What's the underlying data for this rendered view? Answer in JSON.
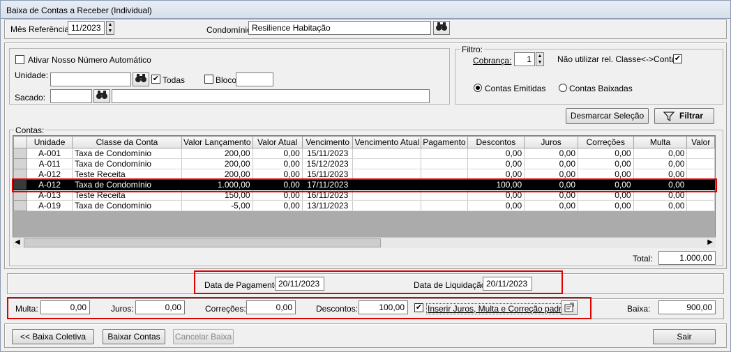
{
  "window": {
    "title": "Baixa de Contas a Receber (Individual)"
  },
  "header": {
    "mes_label": "Mês Referência:",
    "mes_value": "11/2023",
    "condominio_label": "Condomínio:",
    "condominio_value": "Resilience Habitação"
  },
  "options": {
    "ativar_label": "Ativar Nosso Número Automático",
    "unidade_label": "Unidade:",
    "unidade_value": "",
    "todas_label": "Todas",
    "bloco_label": "Bloco",
    "bloco_value": "",
    "sacado_label": "Sacado:",
    "sacado_code": "",
    "sacado_name": ""
  },
  "filter": {
    "legend": "Filtro:",
    "cobranca_label": "Cobrança:",
    "cobranca_value": "1",
    "nao_utilizar_label": "Não utilizar rel. Classe<->Conta",
    "contas_emitidas_label": "Contas Emitidas",
    "contas_baixadas_label": "Contas Baixadas",
    "desmarcar_label": "Desmarcar Seleção",
    "filtrar_label": "Filtrar"
  },
  "contas": {
    "legend": "Contas:",
    "columns": [
      "",
      "Unidade",
      "Classe da Conta",
      "Valor Lançamento",
      "Valor Atual",
      "Vencimento",
      "Vencimento Atual",
      "Pagamento",
      "Descontos",
      "Juros",
      "Correções",
      "Multa",
      "Valor"
    ],
    "rows": [
      [
        "A-001",
        "Taxa de Condomínio",
        "200,00",
        "0,00",
        "15/11/2023",
        "",
        "",
        "0,00",
        "0,00",
        "0,00",
        "0,00"
      ],
      [
        "A-011",
        "Taxa de Condomínio",
        "200,00",
        "0,00",
        "15/12/2023",
        "",
        "",
        "0,00",
        "0,00",
        "0,00",
        "0,00"
      ],
      [
        "A-012",
        "Teste Receita",
        "200,00",
        "0,00",
        "15/11/2023",
        "",
        "",
        "0,00",
        "0,00",
        "0,00",
        "0,00"
      ],
      [
        "A-012",
        "Taxa de Condomínio",
        "1.000,00",
        "0,00",
        "17/11/2023",
        "",
        "",
        "100,00",
        "0,00",
        "0,00",
        "0,00"
      ],
      [
        "A-013",
        "Teste Receita",
        "150,00",
        "0,00",
        "16/11/2023",
        "",
        "",
        "0,00",
        "0,00",
        "0,00",
        "0,00"
      ],
      [
        "A-019",
        "Taxa de Condomínio",
        "-5,00",
        "0,00",
        "13/11/2023",
        "",
        "",
        "0,00",
        "0,00",
        "0,00",
        "0,00"
      ]
    ],
    "selected_row": 3,
    "total_label": "Total:",
    "total_value": "1.000,00"
  },
  "datas": {
    "pagamento_label": "Data de Pagamento:",
    "pagamento_value": "20/11/2023",
    "liquidacao_label": "Data de Liquidação:",
    "liquidacao_value": "20/11/2023"
  },
  "valores": {
    "multa_label": "Multa:",
    "multa_value": "0,00",
    "juros_label": "Juros:",
    "juros_value": "0,00",
    "correcoes_label": "Correções:",
    "correcoes_value": "0,00",
    "descontos_label": "Descontos:",
    "descontos_value": "100,00",
    "inserir_label": "Inserir Juros, Multa e Correção padrão",
    "baixa_label": "Baixa:",
    "baixa_value": "900,00"
  },
  "footer": {
    "baixa_coletiva": "<< Baixa Coletiva",
    "baixar_contas": "Baixar Contas",
    "cancelar_baixa": "Cancelar Baixa",
    "sair": "Sair"
  },
  "colors": {
    "highlight": "#e00000",
    "selected_row": "#000000"
  },
  "icons": {
    "binoculars": "binoculars-icon",
    "funnel": "funnel-icon",
    "properties": "properties-icon"
  }
}
